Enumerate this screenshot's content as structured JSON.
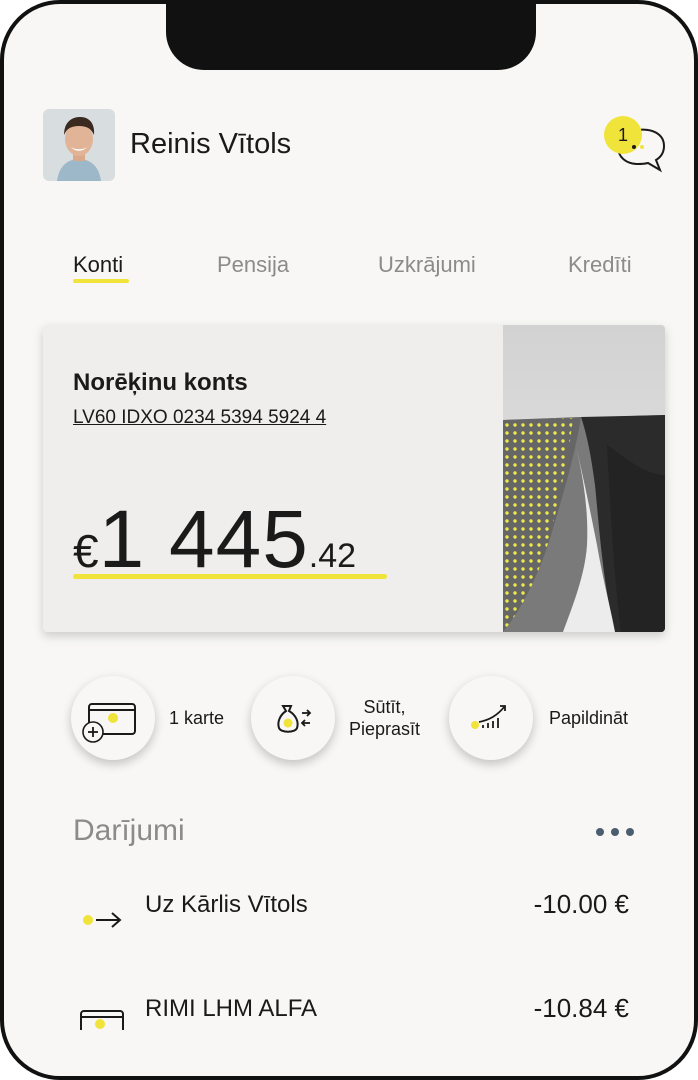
{
  "profile": {
    "name": "Reinis Vītols"
  },
  "messages": {
    "unread_count": "1",
    "icon": "chat-icon"
  },
  "tabs": [
    {
      "label": "Konti",
      "active": true
    },
    {
      "label": "Pensija",
      "active": false
    },
    {
      "label": "Uzkrājumi",
      "active": false
    },
    {
      "label": "Kredīti",
      "active": false
    }
  ],
  "account": {
    "title": "Norēķinu konts",
    "iban": "LV60 IDXO 0234 5394 5924 4",
    "currency_symbol": "€",
    "balance_main": "1 445",
    "balance_decimals": ".42"
  },
  "actions": [
    {
      "label": "1 karte",
      "icon": "card-add-icon"
    },
    {
      "label_line1": "Sūtīt,",
      "label_line2": "Pieprasīt",
      "icon": "money-bag-transfer-icon"
    },
    {
      "label": "Papildināt",
      "icon": "growth-chart-icon"
    }
  ],
  "transactions_section": {
    "title": "Darījumi"
  },
  "transactions": [
    {
      "name": "Uz Kārlis Vītols",
      "amount": "-10.00 €",
      "icon": "outgoing-arrow-icon"
    },
    {
      "name": "RIMI LHM ALFA",
      "amount": "-10.84 €",
      "icon": "card-payment-icon"
    }
  ],
  "colors": {
    "accent": "#f0e33a",
    "text": "#1a1a1a",
    "muted": "#8b8b8b",
    "background": "#f8f7f5",
    "dots": "#4a5e70"
  }
}
